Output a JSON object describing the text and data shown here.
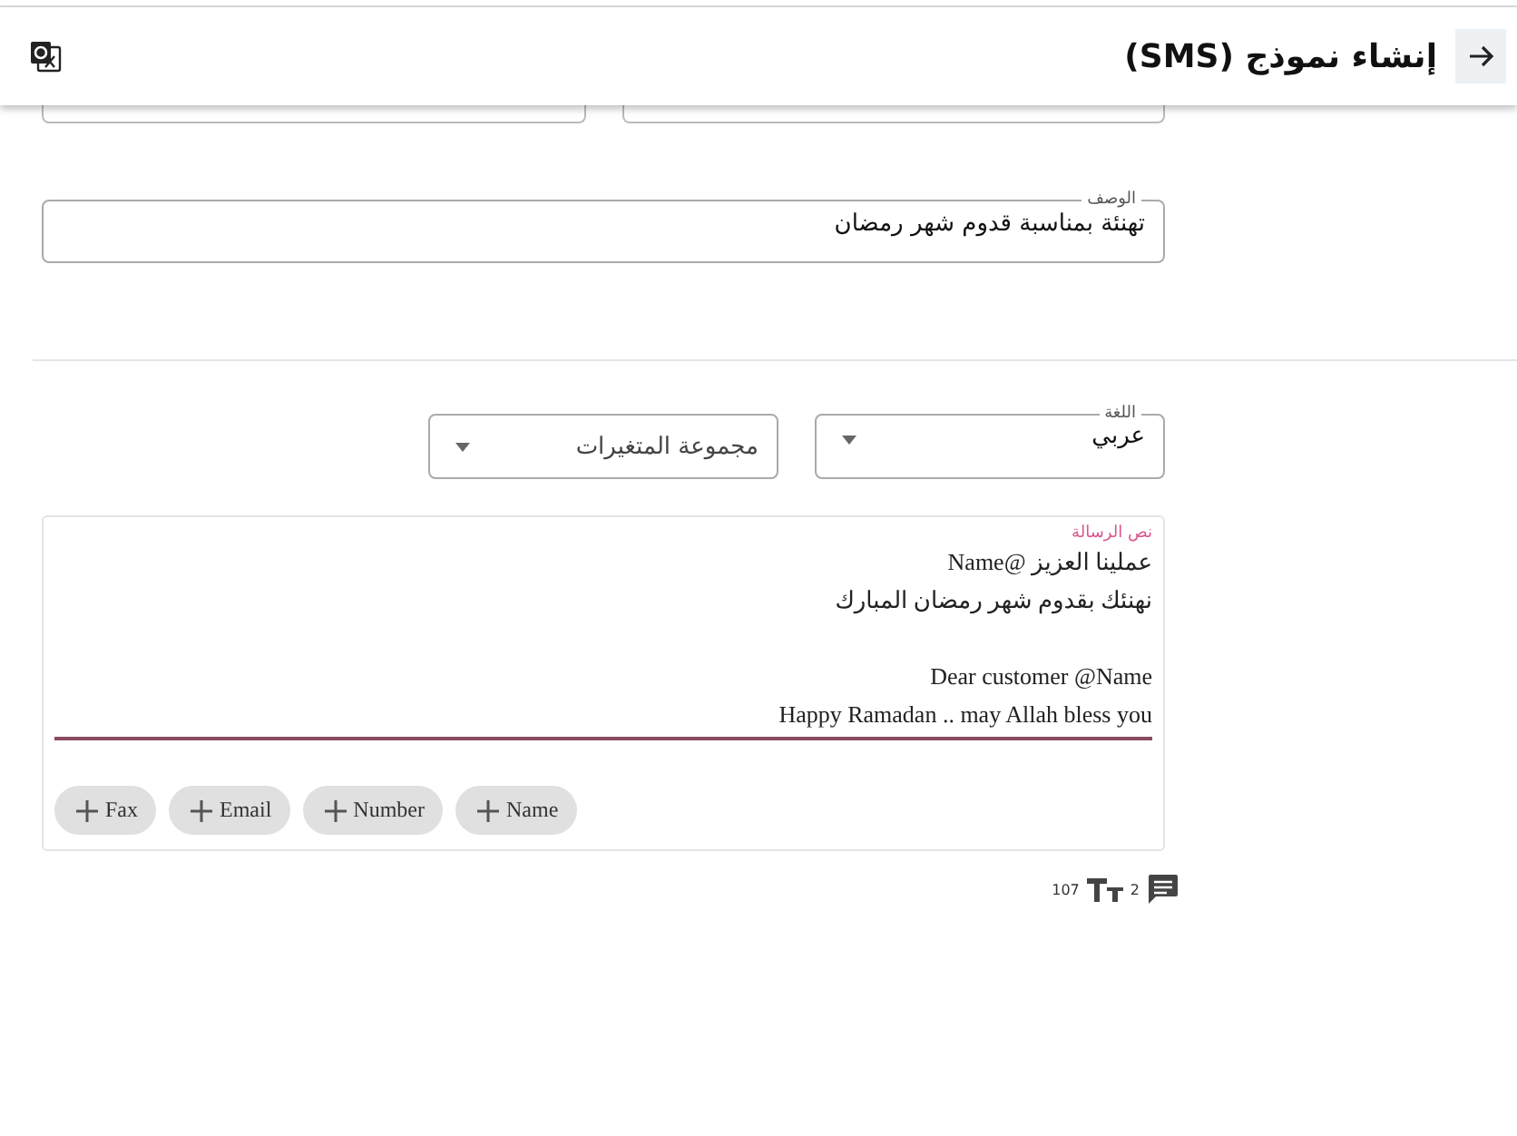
{
  "header": {
    "title": "إنشاء نموذج (SMS)"
  },
  "description": {
    "label": "الوصف",
    "value": "تهنئة بمناسبة قدوم شهر رمضان"
  },
  "language": {
    "label": "اللغة",
    "value": "عربي"
  },
  "variables": {
    "placeholder": "مجموعة المتغيرات"
  },
  "message": {
    "label": "نص الرسالة",
    "paragraphs": [
      {
        "lines": [
          "عملينا العزيز @Name",
          "نهنئك بقدوم شهر رمضان المبارك"
        ]
      },
      {
        "lines": [
          "Dear customer @Name",
          "Happy Ramadan .. may Allah bless you"
        ]
      }
    ],
    "chips": [
      {
        "label": "Name"
      },
      {
        "label": "Number"
      },
      {
        "label": "Email"
      },
      {
        "label": "Fax"
      }
    ]
  },
  "counters": {
    "characters": "107",
    "messages": "2"
  }
}
